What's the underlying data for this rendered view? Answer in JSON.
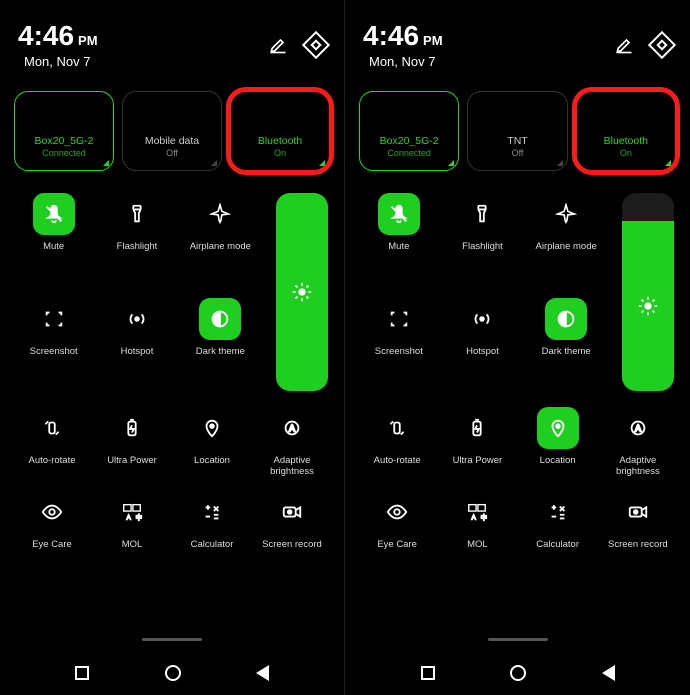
{
  "accent": "#1fcf1f",
  "panels": [
    {
      "clock": {
        "time": "4:46",
        "ampm": "PM"
      },
      "date": "Mon, Nov 7",
      "tiles": [
        {
          "icon": "wifi",
          "label": "Box20_5G-2",
          "sub": "Connected",
          "active": true,
          "highlighted": false
        },
        {
          "icon": "data",
          "label": "Mobile data",
          "sub": "Off",
          "active": false,
          "highlighted": false
        },
        {
          "icon": "bluetooth",
          "label": "Bluetooth",
          "sub": "On",
          "active": true,
          "highlighted": true
        }
      ],
      "brightness_pct": 100,
      "row1": [
        {
          "icon": "mute",
          "label": "Mute",
          "on": true
        },
        {
          "icon": "flashlight",
          "label": "Flashlight",
          "on": false
        },
        {
          "icon": "airplane",
          "label": "Airplane mode",
          "on": false
        }
      ],
      "row2": [
        {
          "icon": "screenshot",
          "label": "Screenshot",
          "on": false
        },
        {
          "icon": "hotspot",
          "label": "Hotspot",
          "on": false
        },
        {
          "icon": "darktheme",
          "label": "Dark theme",
          "on": true
        }
      ],
      "row3": [
        {
          "icon": "rotate",
          "label": "Auto-rotate",
          "on": false
        },
        {
          "icon": "battery",
          "label": "Ultra Power",
          "on": false
        },
        {
          "icon": "location",
          "label": "Location",
          "on": false
        },
        {
          "icon": "adaptive",
          "label": "Adaptive brightness",
          "on": false
        }
      ],
      "row4": [
        {
          "icon": "eye",
          "label": "Eye Care",
          "on": false
        },
        {
          "icon": "mol",
          "label": "MOL",
          "on": false
        },
        {
          "icon": "calc",
          "label": "Calculator",
          "on": false
        },
        {
          "icon": "record",
          "label": "Screen record",
          "on": false
        }
      ]
    },
    {
      "clock": {
        "time": "4:46",
        "ampm": "PM"
      },
      "date": "Mon, Nov 7",
      "tiles": [
        {
          "icon": "wifi",
          "label": "Box20_5G-2",
          "sub": "Connected",
          "active": true,
          "highlighted": false
        },
        {
          "icon": "data",
          "label": "TNT",
          "sub": "Off",
          "active": false,
          "highlighted": false
        },
        {
          "icon": "bluetooth",
          "label": "Bluetooth",
          "sub": "On",
          "active": true,
          "highlighted": true
        }
      ],
      "brightness_pct": 86,
      "row1": [
        {
          "icon": "mute",
          "label": "Mute",
          "on": true
        },
        {
          "icon": "flashlight",
          "label": "Flashlight",
          "on": false
        },
        {
          "icon": "airplane",
          "label": "Airplane mode",
          "on": false
        }
      ],
      "row2": [
        {
          "icon": "screenshot",
          "label": "Screenshot",
          "on": false
        },
        {
          "icon": "hotspot",
          "label": "Hotspot",
          "on": false
        },
        {
          "icon": "darktheme",
          "label": "Dark theme",
          "on": true
        }
      ],
      "row3": [
        {
          "icon": "rotate",
          "label": "Auto-rotate",
          "on": false
        },
        {
          "icon": "battery",
          "label": "Ultra Power",
          "on": false
        },
        {
          "icon": "location",
          "label": "Location",
          "on": true
        },
        {
          "icon": "adaptive",
          "label": "Adaptive brightness",
          "on": false
        }
      ],
      "row4": [
        {
          "icon": "eye",
          "label": "Eye Care",
          "on": false
        },
        {
          "icon": "mol",
          "label": "MOL",
          "on": false
        },
        {
          "icon": "calc",
          "label": "Calculator",
          "on": false
        },
        {
          "icon": "record",
          "label": "Screen record",
          "on": false
        }
      ]
    }
  ]
}
